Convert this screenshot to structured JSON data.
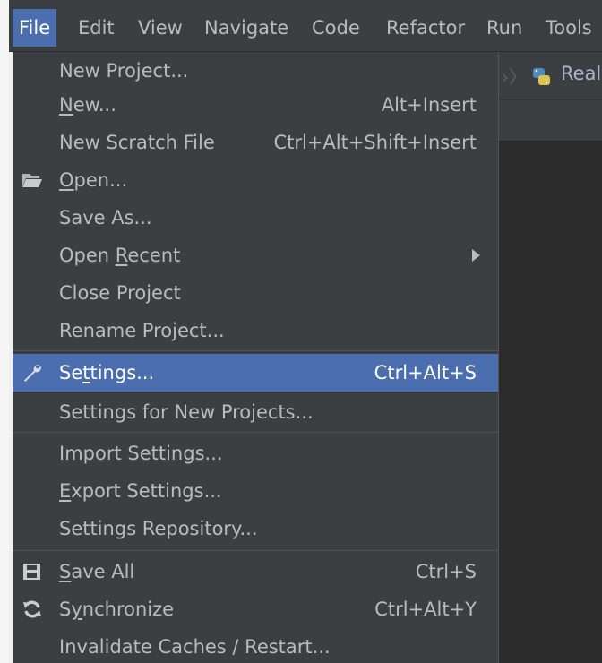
{
  "menubar": {
    "items": [
      "File",
      "Edit",
      "View",
      "Navigate",
      "Code",
      "Refactor",
      "Run",
      "Tools"
    ],
    "active": "File"
  },
  "breadcrumb": {
    "label": "Real"
  },
  "file_menu": {
    "items": [
      {
        "label": "New Project...",
        "shortcut": "",
        "icon": "",
        "mnemonic": ""
      },
      {
        "label": "New...",
        "shortcut": "Alt+Insert",
        "icon": "",
        "mnemonic": "N"
      },
      {
        "label": "New Scratch File",
        "shortcut": "Ctrl+Alt+Shift+Insert",
        "icon": "",
        "mnemonic": ""
      },
      {
        "label": "Open...",
        "shortcut": "",
        "icon": "folder-open-icon",
        "mnemonic": "O"
      },
      {
        "label": "Save As...",
        "shortcut": "",
        "icon": "",
        "mnemonic": ""
      },
      {
        "label": "Open Recent",
        "shortcut": "",
        "icon": "",
        "mnemonic": "R",
        "submenu": true
      },
      {
        "label": "Close Project",
        "shortcut": "",
        "icon": "",
        "mnemonic": ""
      },
      {
        "label": "Rename Project...",
        "shortcut": "",
        "icon": "",
        "mnemonic": ""
      },
      {
        "label": "Settings...",
        "shortcut": "Ctrl+Alt+S",
        "icon": "wrench-icon",
        "mnemonic": "t",
        "highlighted": true
      },
      {
        "label": "Settings for New Projects...",
        "shortcut": "",
        "icon": "",
        "mnemonic": ""
      },
      {
        "label": "Import Settings...",
        "shortcut": "",
        "icon": "",
        "mnemonic": ""
      },
      {
        "label": "Export Settings...",
        "shortcut": "",
        "icon": "",
        "mnemonic": "E"
      },
      {
        "label": "Settings Repository...",
        "shortcut": "",
        "icon": "",
        "mnemonic": ""
      },
      {
        "label": "Save All",
        "shortcut": "Ctrl+S",
        "icon": "save-all-icon",
        "mnemonic": "S"
      },
      {
        "label": "Synchronize",
        "shortcut": "Ctrl+Alt+Y",
        "icon": "synchronize-icon",
        "mnemonic": "y"
      },
      {
        "label": "Invalidate Caches / Restart...",
        "shortcut": "",
        "icon": "",
        "mnemonic": ""
      }
    ]
  },
  "colors": {
    "menu_background": "#3c3f41",
    "highlight": "#4b6eaf",
    "text": "#bbbbbb",
    "editor_background": "#2b2b2b"
  }
}
